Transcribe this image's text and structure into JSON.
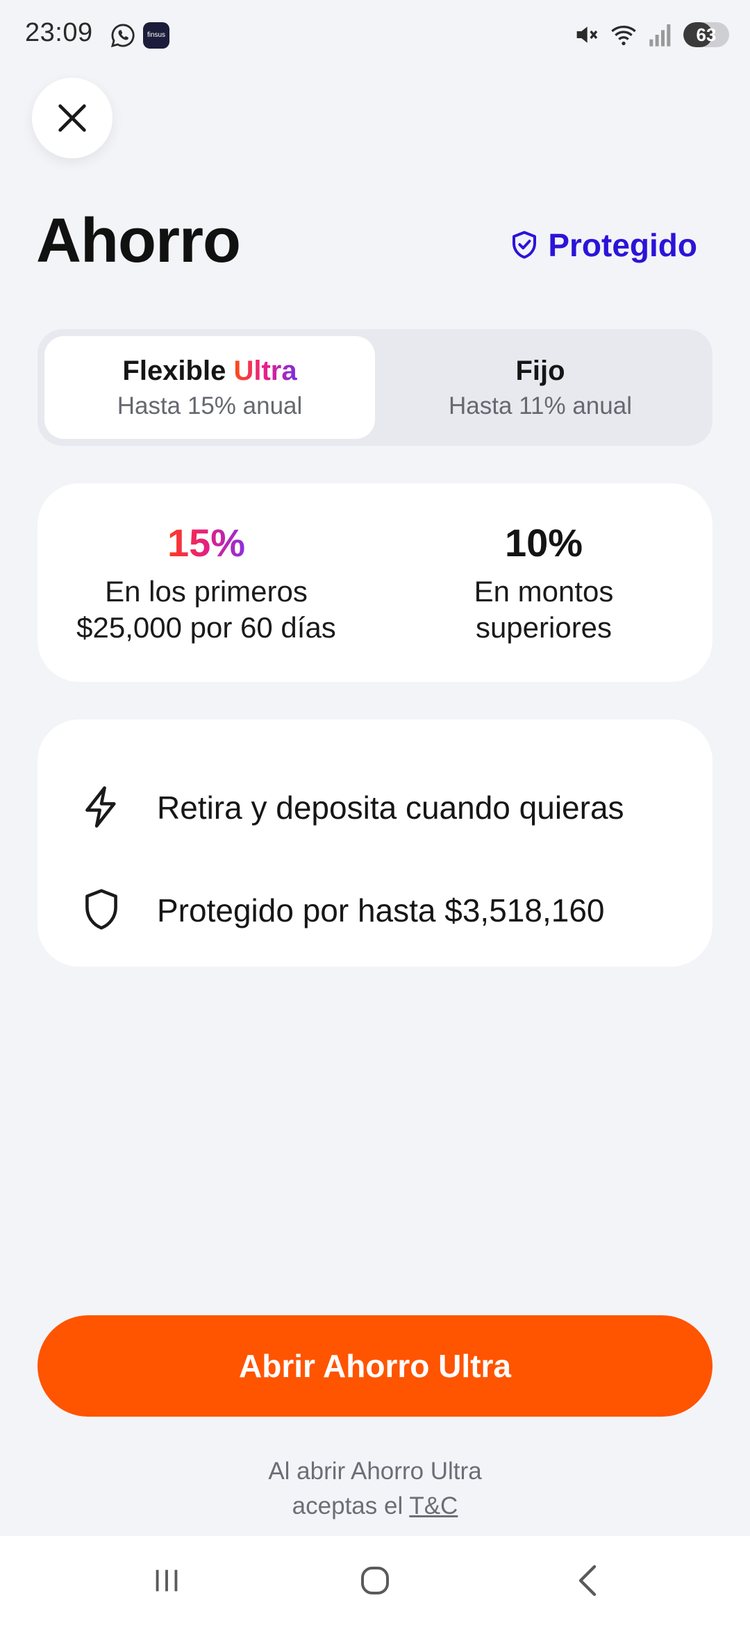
{
  "status_bar": {
    "time": "23:09",
    "app_badge": "finsus",
    "battery_level": "63",
    "icons": [
      "whatsapp-icon",
      "muted-icon",
      "wifi-icon",
      "signal-icon",
      "battery-icon"
    ]
  },
  "header": {
    "title": "Ahorro",
    "protected_label": "Protegido",
    "close_icon": "close-icon"
  },
  "tabs": [
    {
      "label_main": "Flexible",
      "label_accent": "Ultra",
      "subtitle": "Hasta 15% anual",
      "active": true
    },
    {
      "label_main": "Fijo",
      "label_accent": "",
      "subtitle": "Hasta 11% anual",
      "active": false
    }
  ],
  "rates": [
    {
      "percent": "15%",
      "line1": "En los primeros",
      "line2": "$25,000 por 60 días"
    },
    {
      "percent": "10%",
      "line1": "En montos",
      "line2": "superiores"
    }
  ],
  "features": [
    {
      "icon": "lightning-icon",
      "text": "Retira y deposita cuando quieras"
    },
    {
      "icon": "shield-icon",
      "text": "Protegido por hasta $3,518,160"
    }
  ],
  "cta": {
    "label": "Abrir Ahorro Ultra"
  },
  "terms": {
    "line1": "Al abrir Ahorro Ultra",
    "line2_prefix": "aceptas el ",
    "link": "T&C"
  },
  "colors": {
    "accent_orange": "#ff5400",
    "link_blue": "#2b14d8",
    "background": "#f3f4f8"
  },
  "nav_bar": {
    "icons": [
      "recents-icon",
      "home-icon",
      "back-icon"
    ]
  }
}
